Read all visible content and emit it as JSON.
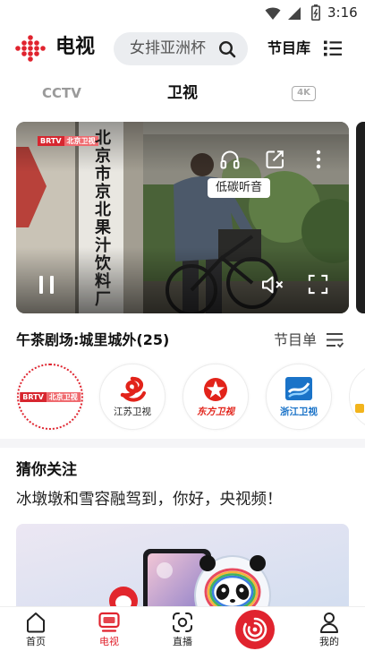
{
  "status_bar": {
    "time": "3:16",
    "icons": [
      "wifi-icon",
      "signal-icon",
      "battery-icon"
    ]
  },
  "header": {
    "logo_icon": "cctv-dots-logo-icon",
    "title": "电视",
    "search_placeholder": "女排亚洲杯",
    "search_icon": "search-icon",
    "library_label": "节目库",
    "library_icon": "list-icon"
  },
  "tabs": [
    {
      "label": "CCTV",
      "active": false
    },
    {
      "label": "卫视",
      "active": true
    },
    {
      "label": "4K",
      "active": false
    }
  ],
  "player": {
    "watermark_logo": "BRTV",
    "watermark_channel": "北京卫视",
    "sign_text": "北京市京北果汁饮料厂",
    "audio_mode_tooltip": "低碳听音",
    "paused": false,
    "muted": true,
    "controls": [
      "headphone-icon",
      "share-icon",
      "more-vertical-icon",
      "pause-icon",
      "mute-icon",
      "fullscreen-icon"
    ]
  },
  "now_playing": {
    "title": "午茶剧场:城里城外(25)",
    "schedule_label": "节目单",
    "schedule_icon": "schedule-list-icon"
  },
  "channels": [
    {
      "logo_text": "BRTV",
      "name": "北京卫视",
      "selected": true
    },
    {
      "name": "江苏卫视",
      "selected": false
    },
    {
      "name": "东方卫视",
      "selected": false
    },
    {
      "name": "浙江卫视",
      "selected": false
    }
  ],
  "recommend": {
    "heading": "猜你关注",
    "item_title": "冰墩墩和雪容融驾到，你好，央视频！"
  },
  "bottom_nav": [
    {
      "label": "首页",
      "icon": "home-icon",
      "active": false
    },
    {
      "label": "电视",
      "icon": "tv-icon",
      "active": true
    },
    {
      "label": "直播",
      "icon": "live-icon",
      "active": false
    },
    {
      "icon": "cctv-video-logo-icon",
      "active": false
    },
    {
      "label": "我的",
      "icon": "user-icon",
      "active": false
    }
  ],
  "colors": {
    "accent": "#e0232e",
    "text_primary": "#111111",
    "text_muted": "#999999",
    "search_bg": "#ebedf0"
  }
}
